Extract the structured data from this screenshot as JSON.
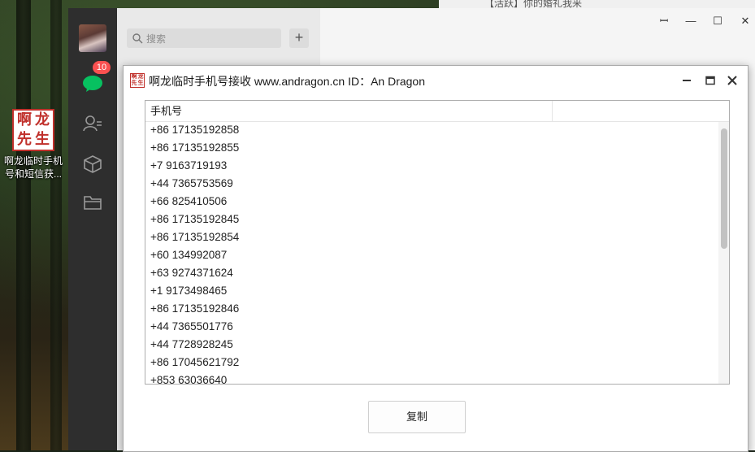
{
  "desktop": {
    "icon_glyphs": [
      "啊",
      "龙",
      "先",
      "生"
    ],
    "icon_label": "啊龙临时手机号和短信获..."
  },
  "wechat": {
    "search_placeholder": "搜索",
    "add_symbol": "+",
    "chat_badge": "10",
    "notification_preview": "【活跃】你的婚礼我来",
    "controls": {
      "pin": "ꟷ",
      "minimize": "—",
      "maximize": "☐",
      "close": "✕"
    }
  },
  "dialog": {
    "title": "啊龙临时手机号接收 www.andragon.cn ID：An Dragon",
    "icon_glyphs": [
      "啊",
      "龙",
      "先",
      "生"
    ],
    "column_header": "手机号",
    "phone_numbers": [
      "+86 17135192858",
      "+86 17135192855",
      "+7 9163719193",
      "+44 7365753569",
      "+66 825410506",
      "+86 17135192845",
      "+86 17135192854",
      "+60 134992087",
      "+63 9274371624",
      "+1 9173498465",
      "+86 17135192846",
      "+44 7365501776",
      "+44 7728928245",
      "+86 17045621792",
      "+853 63036640"
    ],
    "copy_button": "复制"
  },
  "colors": {
    "accent_badge": "#fa5151",
    "wechat_green": "#07c160",
    "logo_red": "#c0302b"
  }
}
